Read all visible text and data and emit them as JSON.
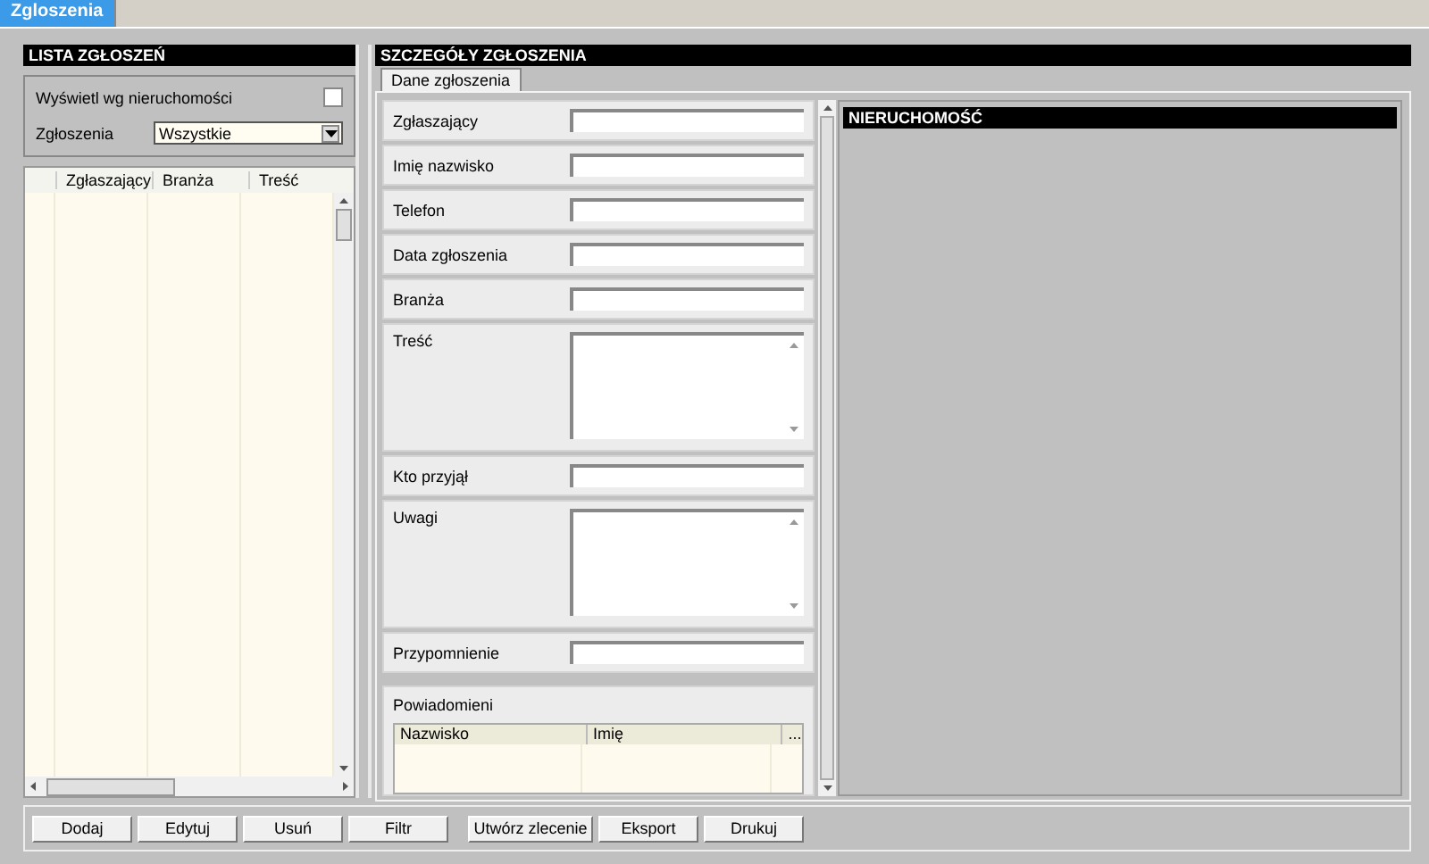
{
  "window": {
    "tab": "Zgloszenia"
  },
  "list_panel": {
    "title": "LISTA ZGŁOSZEŃ",
    "show_by_property": {
      "label": "Wyświetl wg nieruchomości",
      "checked": false
    },
    "filter": {
      "label": "Zgłoszenia",
      "value": "Wszystkie"
    },
    "table": {
      "columns": [
        "Zgłaszający",
        "Branża",
        "Treść"
      ]
    }
  },
  "details_panel": {
    "title": "SZCZEGÓŁY ZGŁOSZENIA",
    "tabs": [
      {
        "label": "Dane zgłoszenia",
        "selected": true
      }
    ],
    "fields": [
      {
        "label": "Zgłaszający",
        "kind": "line"
      },
      {
        "label": "Imię nazwisko",
        "kind": "line"
      },
      {
        "label": "Telefon",
        "kind": "line"
      },
      {
        "label": "Data zgłoszenia",
        "kind": "line"
      },
      {
        "label": "Branża",
        "kind": "line"
      },
      {
        "label": "Treść",
        "kind": "memo"
      },
      {
        "label": "Kto przyjął",
        "kind": "line"
      },
      {
        "label": "Uwagi",
        "kind": "memo"
      },
      {
        "label": "Przypomnienie",
        "kind": "line"
      },
      {
        "label": "Powiadomieni",
        "kind": "grid",
        "columns": [
          "Nazwisko",
          "Imię",
          "..."
        ]
      }
    ],
    "property_panel": {
      "title": "NIERUCHOMOŚĆ"
    }
  },
  "buttons": [
    "Dodaj",
    "Edytuj",
    "Usuń",
    "Filtr",
    "Utwórz zlecenie",
    "Eksport",
    "Drukuj"
  ]
}
